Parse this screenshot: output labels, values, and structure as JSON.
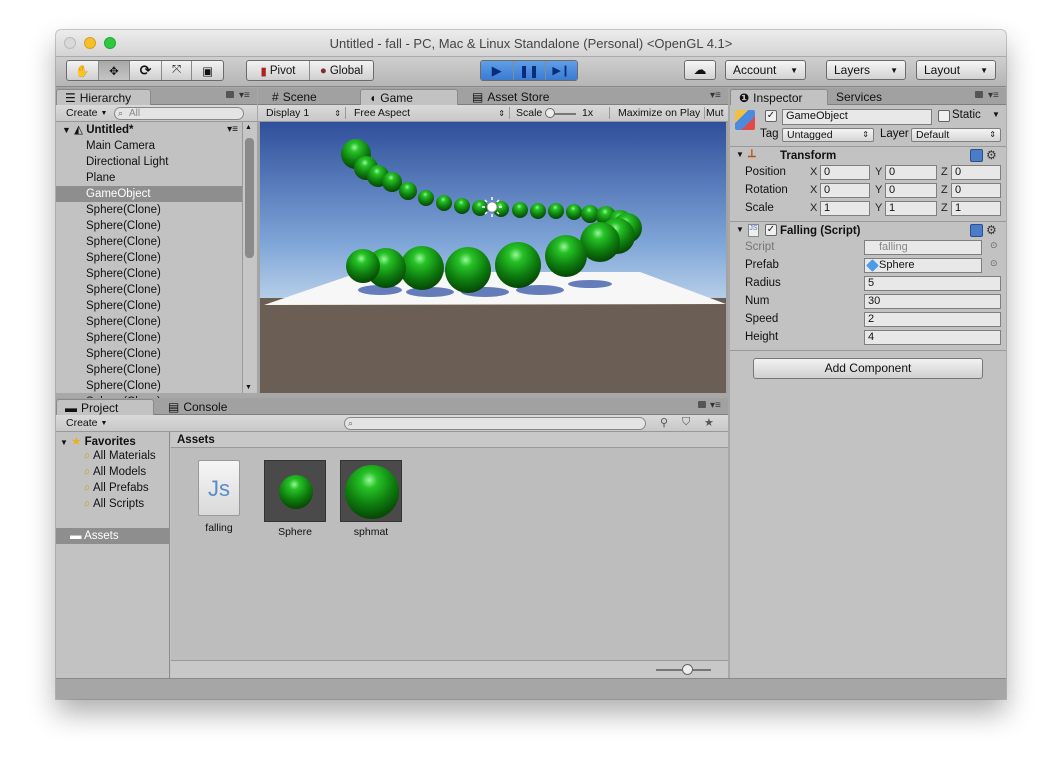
{
  "window": {
    "title": "Untitled - fall - PC, Mac & Linux Standalone (Personal) <OpenGL 4.1>"
  },
  "toolbar": {
    "pivot": "Pivot",
    "global": "Global",
    "account": "Account",
    "layers": "Layers",
    "layout": "Layout"
  },
  "hierarchy": {
    "tab": "Hierarchy",
    "create": "Create",
    "search_placeholder": "All",
    "scene": "Untitled*",
    "items": [
      "Main Camera",
      "Directional Light",
      "Plane",
      "GameObject",
      "Sphere(Clone)",
      "Sphere(Clone)",
      "Sphere(Clone)",
      "Sphere(Clone)",
      "Sphere(Clone)",
      "Sphere(Clone)",
      "Sphere(Clone)",
      "Sphere(Clone)",
      "Sphere(Clone)",
      "Sphere(Clone)",
      "Sphere(Clone)",
      "Sphere(Clone)",
      "Sphere(Clone)"
    ],
    "selected_index": 3
  },
  "center_tabs": {
    "scene": "Scene",
    "game": "Game",
    "asset_store": "Asset Store"
  },
  "game_toolbar": {
    "display": "Display 1",
    "aspect": "Free Aspect",
    "scale_label": "Scale",
    "scale_value": "1x",
    "maximize": "Maximize on Play",
    "mute": "Mut"
  },
  "inspector": {
    "tab": "Inspector",
    "services_tab": "Services",
    "object_name": "GameObject",
    "static_label": "Static",
    "tag_label": "Tag",
    "tag_value": "Untagged",
    "layer_label": "Layer",
    "layer_value": "Default",
    "transform": {
      "title": "Transform",
      "rows": [
        {
          "label": "Position",
          "x": "0",
          "y": "0",
          "z": "0"
        },
        {
          "label": "Rotation",
          "x": "0",
          "y": "0",
          "z": "0"
        },
        {
          "label": "Scale",
          "x": "1",
          "y": "1",
          "z": "1"
        }
      ]
    },
    "script": {
      "title": "Falling (Script)",
      "script_label": "Script",
      "script_value": "falling",
      "prefab_label": "Prefab",
      "prefab_value": "Sphere",
      "radius_label": "Radius",
      "radius_value": "5",
      "num_label": "Num",
      "num_value": "30",
      "speed_label": "Speed",
      "speed_value": "2",
      "height_label": "Height",
      "height_value": "4"
    },
    "add_component": "Add Component"
  },
  "project": {
    "tab": "Project",
    "console_tab": "Console",
    "create": "Create",
    "favorites": "Favorites",
    "fav_items": [
      "All Materials",
      "All Models",
      "All Prefabs",
      "All Scripts"
    ],
    "assets_root": "Assets",
    "breadcrumb": "Assets",
    "assets": [
      {
        "name": "falling",
        "icon": "js-script-icon"
      },
      {
        "name": "Sphere",
        "icon": "prefab-icon"
      },
      {
        "name": "sphmat",
        "icon": "material-icon"
      }
    ]
  },
  "colors": {
    "sphere": "#1f9a1f",
    "selection": "#8e8e8e",
    "play": "#3a7ad2"
  }
}
